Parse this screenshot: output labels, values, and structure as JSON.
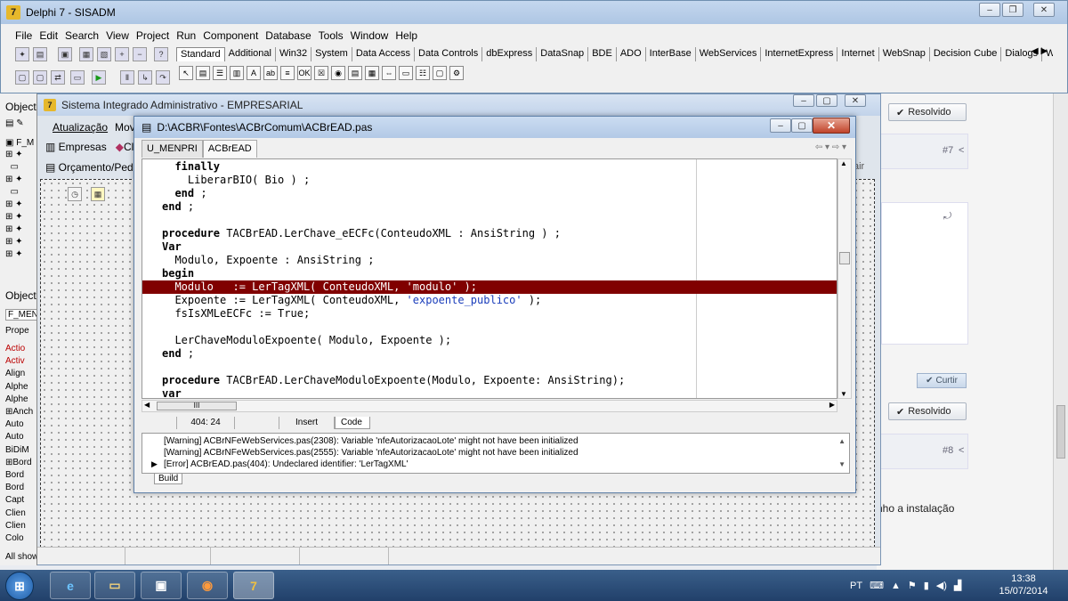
{
  "browser": {
    "resolved_label": "Resolvido",
    "post7": "#7",
    "post8": "#8",
    "curtir_label": "Curtir",
    "partial_text": "nho a instalação",
    "partial_text2": "air"
  },
  "delphi": {
    "title": "Delphi 7 - SISADM",
    "menu": [
      "File",
      "Edit",
      "Search",
      "View",
      "Project",
      "Run",
      "Component",
      "Database",
      "Tools",
      "Window",
      "Help"
    ],
    "palette_tabs": [
      "Standard",
      "Additional",
      "Win32",
      "System",
      "Data Access",
      "Data Controls",
      "dbExpress",
      "DataSnap",
      "BDE",
      "ADO",
      "InterBase",
      "WebServices",
      "InternetExpress",
      "Internet",
      "WebSnap",
      "Decision Cube",
      "Dialogs",
      "Win"
    ]
  },
  "object_inspector": {
    "title1": "Object",
    "title2": "Object",
    "form_combo": "F_MEN",
    "props_tab": "Prope",
    "props": [
      {
        "name": "Actio",
        "red": true
      },
      {
        "name": "Activ",
        "red": true
      },
      {
        "name": "Align",
        "red": false
      },
      {
        "name": "Alphe",
        "red": false
      },
      {
        "name": "Alphe",
        "red": false
      },
      {
        "name": "⊞Anch",
        "red": false
      },
      {
        "name": "Auto",
        "red": false
      },
      {
        "name": "Auto",
        "red": false
      },
      {
        "name": "BiDiM",
        "red": false
      },
      {
        "name": "⊞Bord",
        "red": false
      },
      {
        "name": "Bord",
        "red": false
      },
      {
        "name": "Bord",
        "red": false
      },
      {
        "name": "Capt",
        "red": false
      },
      {
        "name": "Clien",
        "red": false
      },
      {
        "name": "Clien",
        "red": false
      },
      {
        "name": "Colo",
        "red": false
      }
    ],
    "all_shown": "All show",
    "tree_label": "F_M"
  },
  "form": {
    "title": "Sistema Integrado Administrativo - EMPRESARIAL",
    "menu_atualizacao": "Atualização",
    "menu_mov": "Mov",
    "toolbar_empresas": "Empresas",
    "toolbar_cl": "Cl",
    "toolbar_orcamento": "Orçamento/Ped"
  },
  "editor": {
    "title": "D:\\ACBR\\Fontes\\ACBrComum\\ACBrEAD.pas",
    "tabs": [
      "U_MENPRI",
      "ACBrEAD"
    ],
    "code_lines": [
      {
        "segs": [
          {
            "t": "  "
          },
          {
            "t": "finally",
            "k": "kw"
          }
        ]
      },
      {
        "segs": [
          {
            "t": "    LiberarBIO( Bio ) ;"
          }
        ]
      },
      {
        "segs": [
          {
            "t": "  "
          },
          {
            "t": "end",
            "k": "kw"
          },
          {
            "t": " ;"
          }
        ]
      },
      {
        "segs": [
          {
            "t": "end",
            "k": "kw"
          },
          {
            "t": " ;"
          }
        ]
      },
      {
        "segs": [
          {
            "t": ""
          }
        ]
      },
      {
        "segs": [
          {
            "t": "procedure",
            "k": "kw"
          },
          {
            "t": " TACBrEAD.LerChave_eECFc(ConteudoXML : AnsiString ) ;"
          }
        ]
      },
      {
        "segs": [
          {
            "t": "Var",
            "k": "kw"
          }
        ]
      },
      {
        "segs": [
          {
            "t": "  Modulo, Expoente : AnsiString ;"
          }
        ]
      },
      {
        "segs": [
          {
            "t": "begin",
            "k": "kw"
          }
        ]
      },
      {
        "segs": [
          {
            "t": "  Modulo   := LerTagXML( ConteudoXML, 'modulo' );"
          }
        ],
        "highlight": true
      },
      {
        "segs": [
          {
            "t": "  Expoente := LerTagXML( ConteudoXML, "
          },
          {
            "t": "'expoente_publico'",
            "k": "str"
          },
          {
            "t": " );"
          }
        ]
      },
      {
        "segs": [
          {
            "t": "  fsIsXMLeECFc := True;"
          }
        ]
      },
      {
        "segs": [
          {
            "t": ""
          }
        ]
      },
      {
        "segs": [
          {
            "t": "  LerChaveModuloExpoente( Modulo, Expoente );"
          }
        ]
      },
      {
        "segs": [
          {
            "t": "end",
            "k": "kw"
          },
          {
            "t": " ;"
          }
        ]
      },
      {
        "segs": [
          {
            "t": ""
          }
        ]
      },
      {
        "segs": [
          {
            "t": "procedure",
            "k": "kw"
          },
          {
            "t": " TACBrEAD.LerChaveModuloExpoente(Modulo, Expoente: AnsiString);"
          }
        ]
      },
      {
        "segs": [
          {
            "t": "var",
            "k": "kw"
          }
        ]
      }
    ],
    "status_pos": "404: 24",
    "status_mode": "Insert",
    "status_tab": "Code",
    "hscroll_grip": "III",
    "messages": [
      "[Warning] ACBrNFeWebServices.pas(2308): Variable 'nfeAutorizacaoLote' might not have been initialized",
      "[Warning] ACBrNFeWebServices.pas(2555): Variable 'nfeAutorizacaoLote' might not have been initialized",
      "[Error] ACBrEAD.pas(404): Undeclared identifier: 'LerTagXML'"
    ],
    "build_tab": "Build"
  },
  "taskbar": {
    "lang": "PT",
    "time": "13:38",
    "date": "15/07/2014"
  }
}
